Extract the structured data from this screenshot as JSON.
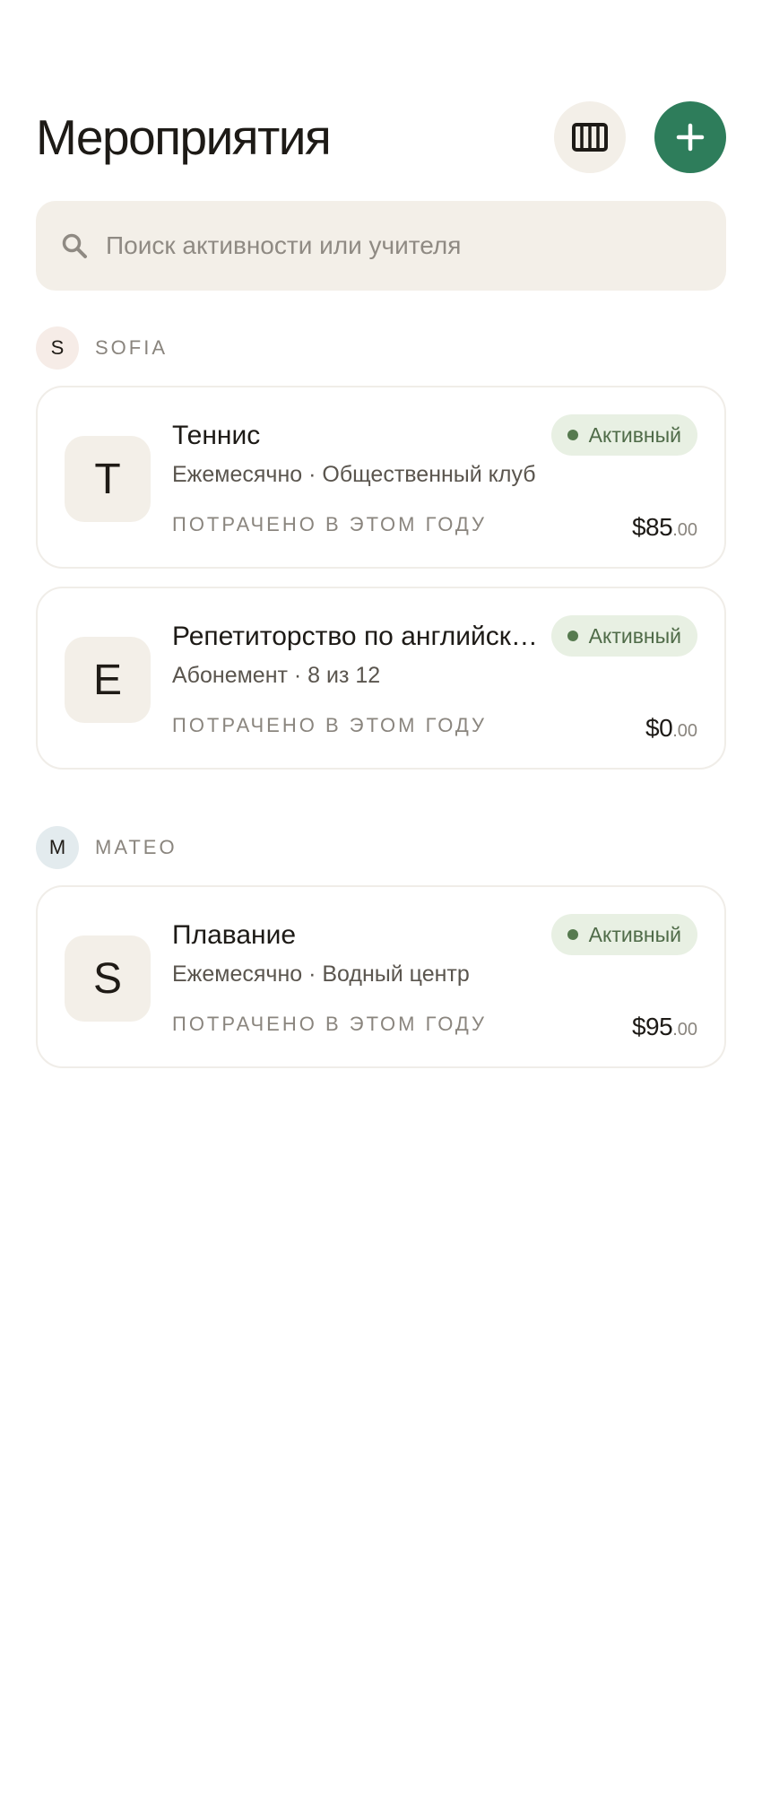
{
  "header": {
    "title": "Мероприятия"
  },
  "search": {
    "placeholder": "Поиск активности или учителя"
  },
  "groups": [
    {
      "initial": "S",
      "name": "SOFIA",
      "activities": [
        {
          "initial": "T",
          "name": "Теннис",
          "subtitle": "Ежемесячно · Общественный клуб",
          "status": "Активный",
          "spent_label": "ПОТРАЧЕНО В ЭТОМ ГОДУ",
          "amount_main": "$85",
          "amount_cents": ".00"
        },
        {
          "initial": "E",
          "name": "Репетиторство по английск…",
          "subtitle": "Абонемент · 8 из 12",
          "status": "Активный",
          "spent_label": "ПОТРАЧЕНО В ЭТОМ ГОДУ",
          "amount_main": "$0",
          "amount_cents": ".00"
        }
      ]
    },
    {
      "initial": "M",
      "name": "MATEO",
      "activities": [
        {
          "initial": "S",
          "name": "Плавание",
          "subtitle": "Ежемесячно · Водный центр",
          "status": "Активный",
          "spent_label": "ПОТРАЧЕНО В ЭТОМ ГОДУ",
          "amount_main": "$95",
          "amount_cents": ".00"
        }
      ]
    }
  ],
  "colors": {
    "accent": "#2e7d5b",
    "surface": "#f3efe8",
    "status_bg": "#e8f0e3",
    "status_fg": "#4f6b48"
  },
  "icons": {
    "view": "calendar-columns-icon",
    "add": "plus-icon",
    "search": "search-icon"
  }
}
